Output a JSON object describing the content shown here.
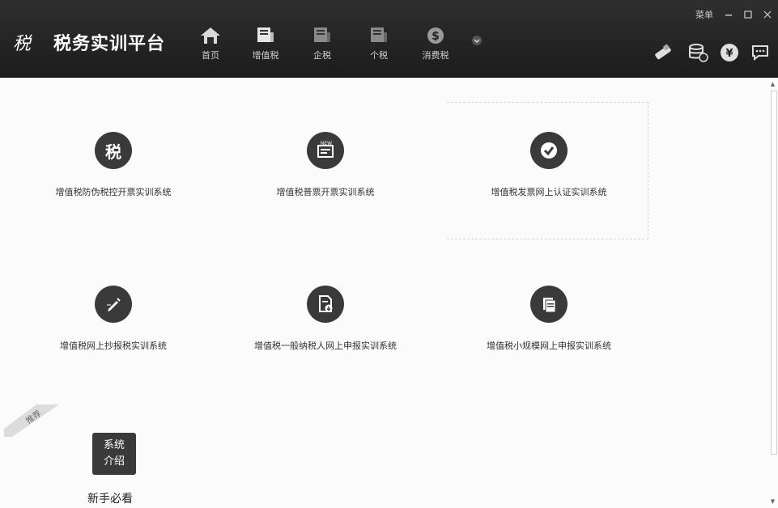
{
  "header": {
    "logo_text": "税",
    "title": "税务实训平台",
    "menu_label": "菜单"
  },
  "nav": [
    {
      "label": "首页",
      "icon": "home-icon"
    },
    {
      "label": "增值税",
      "icon": "document-icon"
    },
    {
      "label": "企税",
      "icon": "document-icon"
    },
    {
      "label": "个税",
      "icon": "document-icon"
    },
    {
      "label": "消费税",
      "icon": "dollar-icon"
    }
  ],
  "tools": [
    "usb-key-icon",
    "database-icon",
    "yen-coin-icon",
    "chat-icon"
  ],
  "tiles": [
    {
      "label": "增值税防伪税控开票实训系统",
      "icon": "tax-char-icon",
      "glyph": "税"
    },
    {
      "label": "增值税普票开票实训系统",
      "icon": "new-invoice-icon",
      "badge": "NEW"
    },
    {
      "label": "增值税发票网上认证实训系统",
      "icon": "check-icon"
    },
    {
      "label": "增值税网上抄报税实训系统",
      "icon": "pencil-icon"
    },
    {
      "label": "增值税一般纳税人网上申报实训系统",
      "icon": "file-download-icon"
    },
    {
      "label": "增值税小规模网上申报实训系统",
      "icon": "papers-icon"
    }
  ],
  "recommend": {
    "ribbon_label": "推荐",
    "tile_line1": "系统",
    "tile_line2": "介绍",
    "caption": "新手必看"
  },
  "colors": {
    "header_bg": "#262626",
    "icon_bg": "#3a3a3a",
    "nav_text": "#cfcfcf"
  }
}
